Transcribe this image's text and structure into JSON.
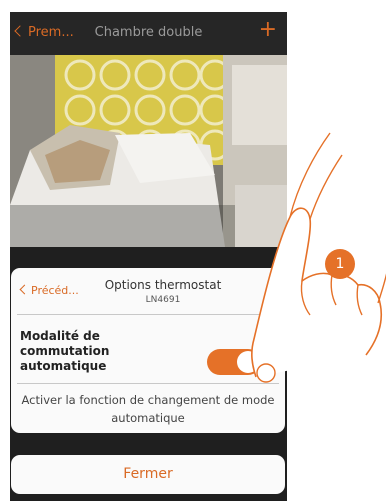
{
  "topbar": {
    "back_label": "Prem...",
    "title": "Chambre double",
    "add_symbol": "+"
  },
  "card": {
    "back_label": "Précéd...",
    "title": "Options thermostat",
    "subtitle": "LN4691",
    "option_label": "Modalité de commutation automatique",
    "toggle_on": true,
    "description": "Activer la fonction de changement de mode automatique"
  },
  "close_button": {
    "label": "Fermer"
  },
  "callout": {
    "number": "1"
  },
  "colors": {
    "accent": "#e57128",
    "topbar": "#262626",
    "card": "#fafafa"
  }
}
